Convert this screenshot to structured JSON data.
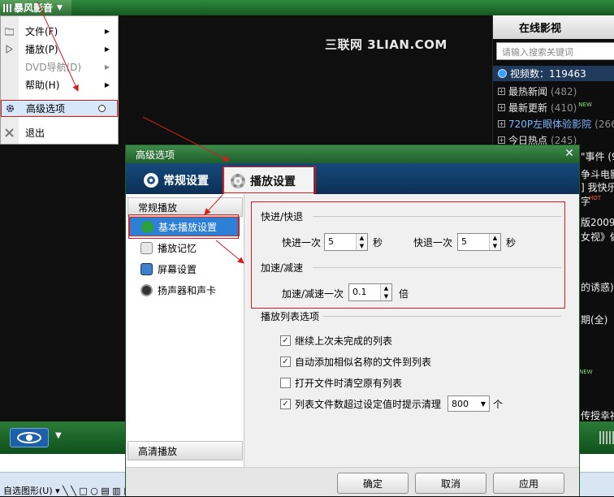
{
  "app": {
    "menu_button": "暴风影音",
    "watermark": "三联网 3LIAN.COM"
  },
  "app_menu": {
    "items": [
      {
        "label": "文件(F)"
      },
      {
        "label": "播放(P)"
      },
      {
        "label": "DVD导航(D)"
      },
      {
        "label": "帮助(H)"
      },
      {
        "label": "高级选项"
      },
      {
        "label": "退出"
      }
    ]
  },
  "online": {
    "title": "在线影视",
    "search_placeholder": "请输入搜索关键词",
    "stat": "视频数：119463",
    "items": [
      {
        "label": "最热新闻",
        "count": "(482)"
      },
      {
        "label": "最新更新",
        "count": "(410)",
        "tag": "NEW"
      },
      {
        "label": "720P左眼体验影院",
        "count": "(2667)"
      },
      {
        "label": "今日热点",
        "count": "(245)"
      }
    ],
    "fragments": [
      "\"事件 (9",
      "争斗电影",
      "] 我快乐",
      "字",
      "版2009:8",
      "女视》做",
      "的诱惑)",
      "期(全)",
      "传授幸福"
    ],
    "fragment_tags": [
      "HOT",
      "NEW"
    ]
  },
  "dialog": {
    "title": "高级选项",
    "tabs": [
      {
        "label": "常规设置"
      },
      {
        "label": "播放设置"
      }
    ],
    "sidebar": {
      "header_top": "常规播放",
      "items": [
        {
          "label": "基本播放设置"
        },
        {
          "label": "播放记忆"
        },
        {
          "label": "屏幕设置"
        },
        {
          "label": "扬声器和声卡"
        }
      ],
      "header_bottom": "高清播放"
    },
    "seek": {
      "section": "快进/快退",
      "forward_label": "快进一次",
      "forward_value": "5",
      "forward_unit": "秒",
      "backward_label": "快退一次",
      "backward_value": "5",
      "backward_unit": "秒"
    },
    "speed": {
      "section": "加速/减速",
      "label": "加速/减速一次",
      "value": "0.1",
      "unit": "倍"
    },
    "playlist": {
      "section": "播放列表选项",
      "options": [
        {
          "label": "继续上次未完成的列表",
          "checked": true
        },
        {
          "label": "自动添加相似名称的文件到列表",
          "checked": true
        },
        {
          "label": "打开文件时清空原有列表",
          "checked": false
        },
        {
          "label": "列表文件数超过设定值时提示清理",
          "checked": true
        }
      ],
      "limit_value": "800",
      "limit_unit": "个"
    },
    "buttons": {
      "ok": "确定",
      "cancel": "取消",
      "apply": "应用"
    }
  },
  "taskbar": {
    "text": "自选图形(U) ▾ ╲ ╲ □ ○ ▤ ▥ ◪ ◐ ◆ ▲ ≡ ≡ ◧ ◨"
  },
  "colors": {
    "player_green": "#1e6a2c",
    "dialog_tab_blue": "#12406c",
    "selection_blue": "#2e7fd6",
    "annotation_red": "#d21e1e"
  }
}
